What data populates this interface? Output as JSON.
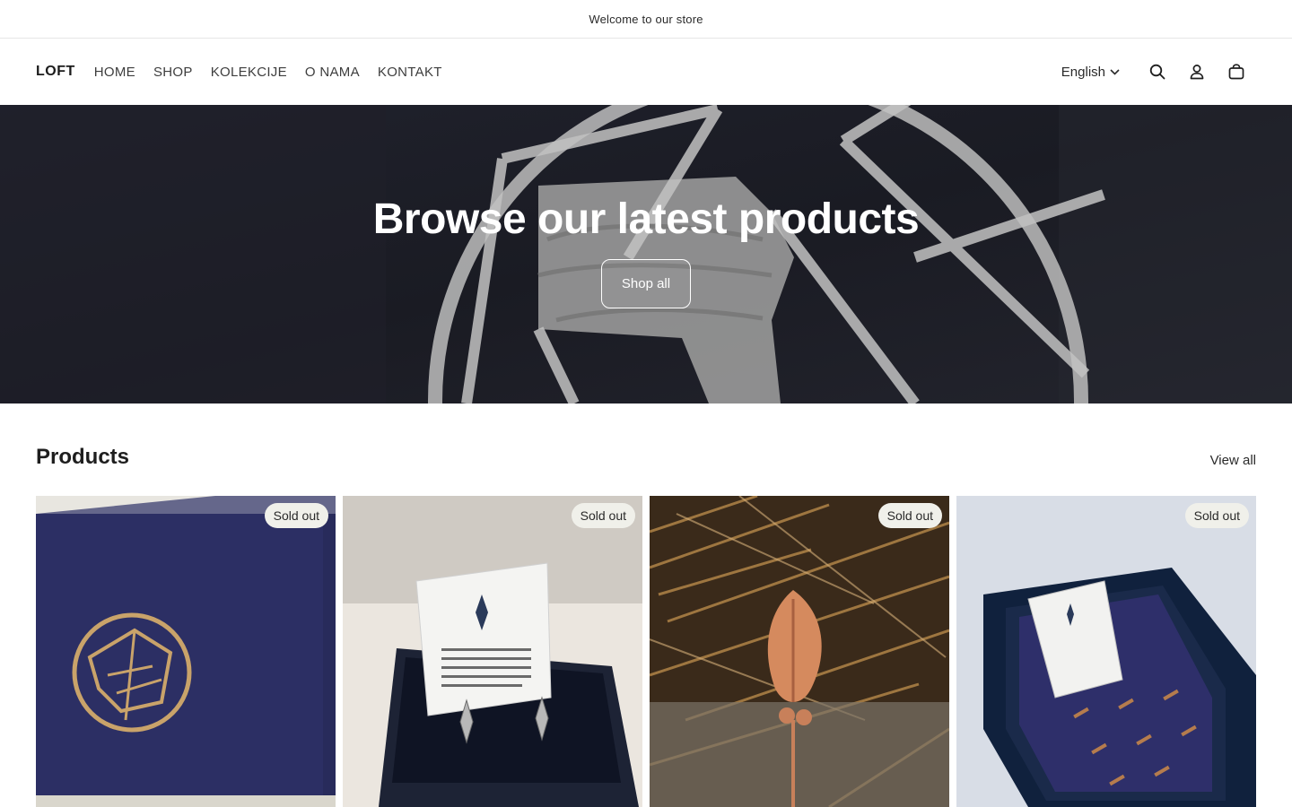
{
  "announcement": {
    "text": "Welcome to our store"
  },
  "header": {
    "logo": "LOFT",
    "nav": [
      "HOME",
      "SHOP",
      "KOLEKCIJE",
      "O NAMA",
      "KONTAKT"
    ],
    "language": "English",
    "icons": [
      "search-icon",
      "account-icon",
      "cart-icon"
    ]
  },
  "hero": {
    "title": "Browse our latest products",
    "button_label": "Shop all"
  },
  "products": {
    "title": "Products",
    "view_all": "View all",
    "items": [
      {
        "badge": "Sold out"
      },
      {
        "badge": "Sold out"
      },
      {
        "badge": "Sold out"
      },
      {
        "badge": "Sold out"
      }
    ]
  }
}
